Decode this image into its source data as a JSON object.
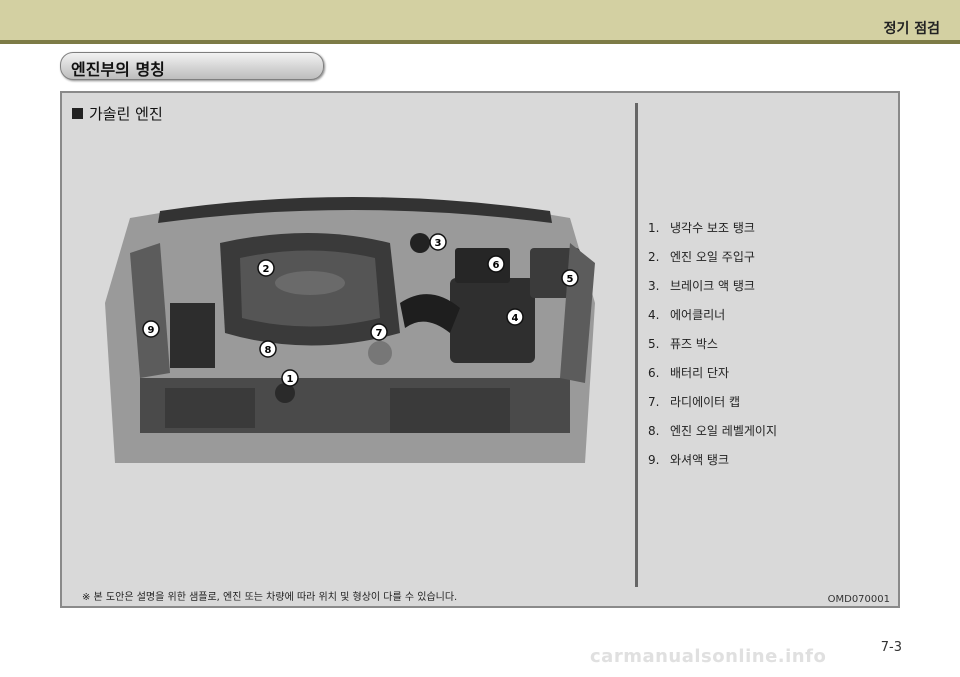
{
  "header": {
    "chapter_title": "정기 점검"
  },
  "section": {
    "title": "엔진부의 명칭"
  },
  "panel": {
    "subtitle": "가솔린 엔진",
    "parts": [
      {
        "num": "1.",
        "label": "냉각수 보조 탱크"
      },
      {
        "num": "2.",
        "label": "엔진 오일 주입구"
      },
      {
        "num": "3.",
        "label": "브레이크 액 탱크"
      },
      {
        "num": "4.",
        "label": "에어클리너"
      },
      {
        "num": "5.",
        "label": "퓨즈 박스"
      },
      {
        "num": "6.",
        "label": "배터리 단자"
      },
      {
        "num": "7.",
        "label": "라디에이터 캡"
      },
      {
        "num": "8.",
        "label": "엔진 오일 레벨게이지"
      },
      {
        "num": "9.",
        "label": "와셔액 탱크"
      }
    ],
    "callouts": [
      "1",
      "2",
      "3",
      "4",
      "5",
      "6",
      "7",
      "8",
      "9"
    ],
    "footnote": "※ 본 도안은 설명을 위한 샘플로, 엔진 또는 차량에 따라 위치 및 형상이 다를 수 있습니다.",
    "image_code": "OMD070001"
  },
  "footer": {
    "page_number": "7-3",
    "watermark": "carmanualsonline.info"
  }
}
